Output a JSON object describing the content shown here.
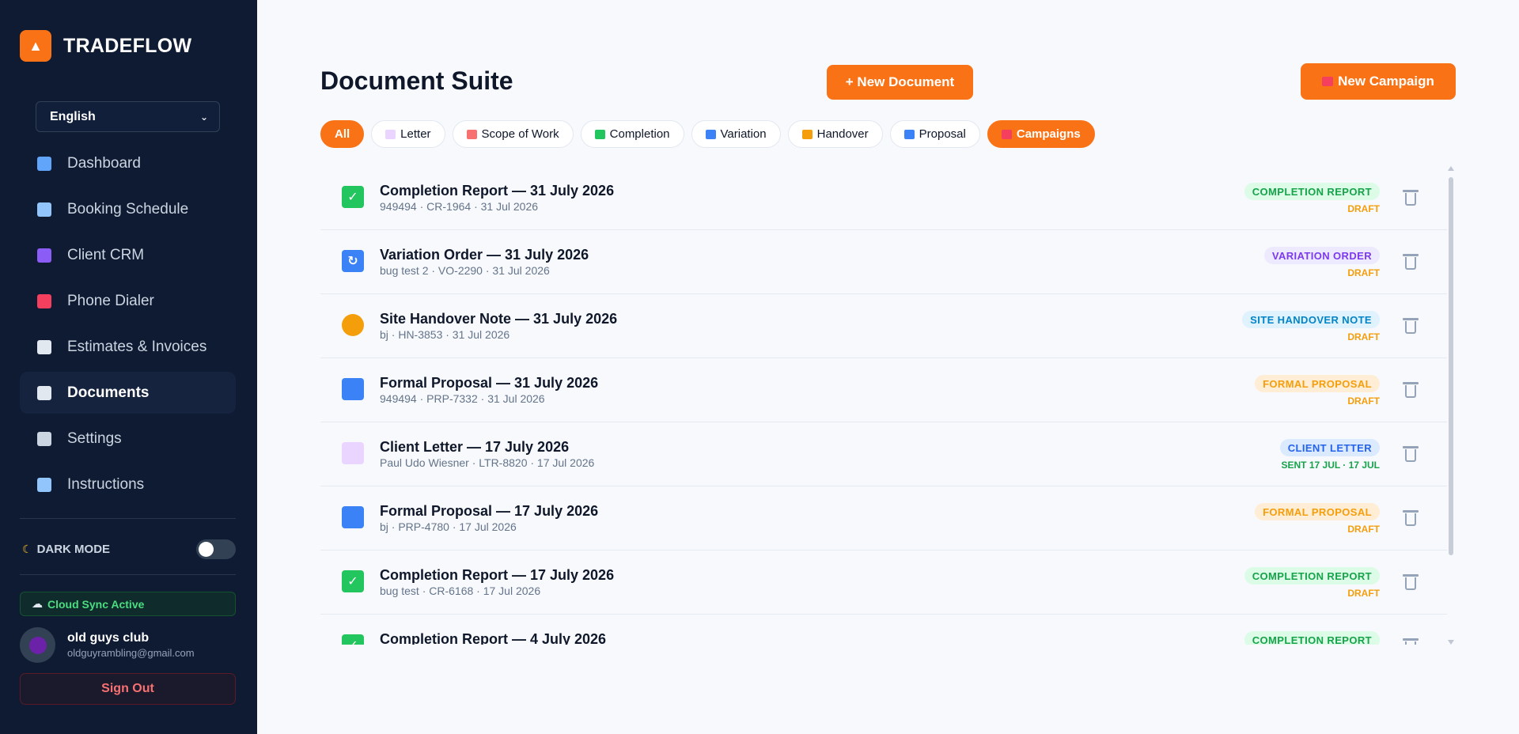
{
  "app": {
    "brand": "TRADEFLOW"
  },
  "sidebar": {
    "language": "English",
    "items": [
      {
        "label": "Dashboard",
        "icon": "chart-icon",
        "color": "#60a5fa"
      },
      {
        "label": "Booking Schedule",
        "icon": "calendar-icon",
        "color": "#93c5fd"
      },
      {
        "label": "Client CRM",
        "icon": "users-icon",
        "color": "#8b5cf6"
      },
      {
        "label": "Phone Dialer",
        "icon": "phone-icon",
        "color": "#f43f5e"
      },
      {
        "label": "Estimates & Invoices",
        "icon": "file-icon",
        "color": "#e2e8f0"
      },
      {
        "label": "Documents",
        "icon": "document-icon",
        "color": "#e2e8f0"
      },
      {
        "label": "Settings",
        "icon": "gear-icon",
        "color": "#cbd5e1"
      },
      {
        "label": "Instructions",
        "icon": "book-icon",
        "color": "#93c5fd"
      }
    ],
    "dark_mode_label": "DARK MODE",
    "dark_mode_icon": "moon-icon",
    "sync_label": "Cloud Sync Active",
    "user_name": "old guys club",
    "user_email": "oldguyrambling@gmail.com",
    "signout_label": "Sign Out"
  },
  "main": {
    "title": "Document Suite",
    "new_document_label": "+ New Document",
    "new_campaign_label": "New Campaign",
    "filters": [
      {
        "label": "All",
        "icon": ""
      },
      {
        "label": "Letter",
        "icon": "envelope-icon",
        "color": "#e9d5ff"
      },
      {
        "label": "Scope of Work",
        "icon": "clipboard-icon",
        "color": "#f87171"
      },
      {
        "label": "Completion",
        "icon": "check-icon",
        "color": "#22c55e"
      },
      {
        "label": "Variation",
        "icon": "refresh-icon",
        "color": "#3b82f6"
      },
      {
        "label": "Handover",
        "icon": "handshake-icon",
        "color": "#f59e0b"
      },
      {
        "label": "Proposal",
        "icon": "chart-icon",
        "color": "#3b82f6"
      },
      {
        "label": "Campaigns",
        "icon": "megaphone-icon",
        "color": "#f43f5e"
      }
    ],
    "documents": [
      {
        "title": "Completion Report — 31 July 2026",
        "sub": "949494 · CR-1964 · 31 Jul 2026",
        "badge": "COMPLETION REPORT",
        "status": "DRAFT",
        "icon": "check-icon",
        "icon_color": "#22c55e",
        "badge_bg": "#dcfce7",
        "badge_fg": "#16a34a",
        "status_color": "#f59e0b"
      },
      {
        "title": "Variation Order — 31 July 2026",
        "sub": "bug test 2 · VO-2290 · 31 Jul 2026",
        "badge": "VARIATION ORDER",
        "status": "DRAFT",
        "icon": "refresh-icon",
        "icon_color": "#3b82f6",
        "badge_bg": "#ede9fe",
        "badge_fg": "#7c3aed",
        "status_color": "#f59e0b"
      },
      {
        "title": "Site Handover Note — 31 July 2026",
        "sub": "bj · HN-3853 · 31 Jul 2026",
        "badge": "SITE HANDOVER NOTE",
        "status": "DRAFT",
        "icon": "handshake-icon",
        "icon_color": "#f59e0b",
        "badge_bg": "#e0f2fe",
        "badge_fg": "#0284c7",
        "status_color": "#f59e0b"
      },
      {
        "title": "Formal Proposal — 31 July 2026",
        "sub": "949494 · PRP-7332 · 31 Jul 2026",
        "badge": "FORMAL PROPOSAL",
        "status": "DRAFT",
        "icon": "chart-icon",
        "icon_color": "#3b82f6",
        "badge_bg": "#ffedd5",
        "badge_fg": "#f59e0b",
        "status_color": "#f59e0b"
      },
      {
        "title": "Client Letter — 17 July 2026",
        "sub": "Paul Udo Wiesner · LTR-8820 · 17 Jul 2026",
        "badge": "CLIENT LETTER",
        "status": "SENT 17 JUL · 17 JUL",
        "icon": "envelope-icon",
        "icon_color": "#e9d5ff",
        "badge_bg": "#dbeafe",
        "badge_fg": "#2563eb",
        "status_color": "#16a34a"
      },
      {
        "title": "Formal Proposal — 17 July 2026",
        "sub": "bj · PRP-4780 · 17 Jul 2026",
        "badge": "FORMAL PROPOSAL",
        "status": "DRAFT",
        "icon": "chart-icon",
        "icon_color": "#3b82f6",
        "badge_bg": "#ffedd5",
        "badge_fg": "#f59e0b",
        "status_color": "#f59e0b"
      },
      {
        "title": "Completion Report — 17 July 2026",
        "sub": "bug test · CR-6168 · 17 Jul 2026",
        "badge": "COMPLETION REPORT",
        "status": "DRAFT",
        "icon": "check-icon",
        "icon_color": "#22c55e",
        "badge_bg": "#dcfce7",
        "badge_fg": "#16a34a",
        "status_color": "#f59e0b"
      },
      {
        "title": "Completion Report — 4 July 2026",
        "sub": "",
        "badge": "COMPLETION REPORT",
        "status": "",
        "icon": "check-icon",
        "icon_color": "#22c55e",
        "badge_bg": "#dcfce7",
        "badge_fg": "#16a34a",
        "status_color": "#f59e0b"
      }
    ]
  },
  "colors": {
    "accent": "#f97316",
    "sidebar": "#0f1b33"
  }
}
